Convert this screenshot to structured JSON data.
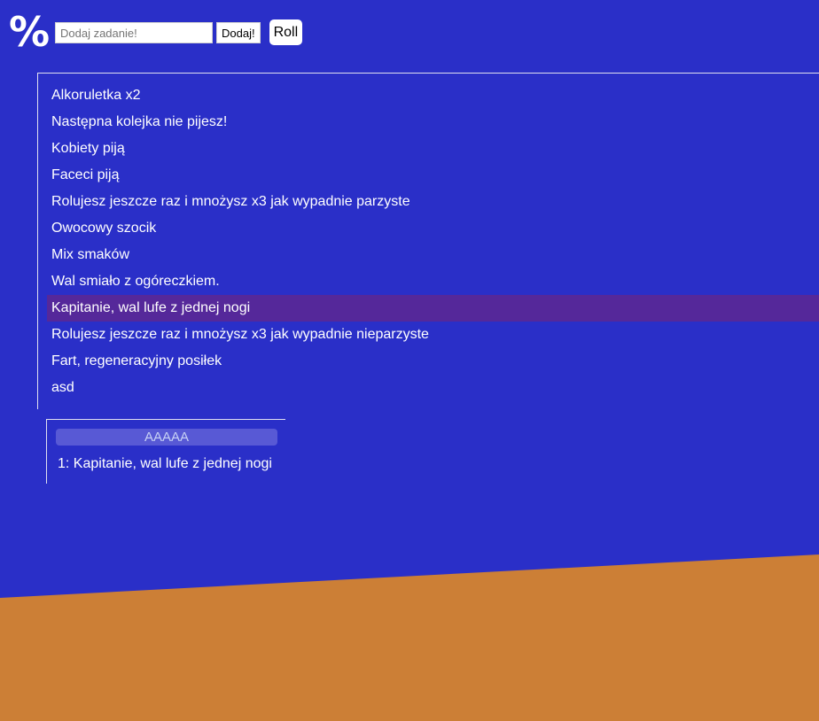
{
  "header": {
    "logo_text": "%",
    "task_input": {
      "placeholder": "Dodaj zadanie!",
      "value": ""
    },
    "add_label": "Dodaj!",
    "roll_label": "Roll"
  },
  "tasks": [
    {
      "label": "Alkoruletka x2"
    },
    {
      "label": "Następna kolejka nie pijesz!"
    },
    {
      "label": "Kobiety piją"
    },
    {
      "label": "Faceci piją"
    },
    {
      "label": "Rolujesz jeszcze raz i mnożysz x3 jak wypadnie parzyste"
    },
    {
      "label": "Owocowy szocik"
    },
    {
      "label": "Mix smaków"
    },
    {
      "label": "Wal smiało z ogóreczkiem."
    },
    {
      "label": "Kapitanie, wal lufe z jednej nogi"
    },
    {
      "label": "Rolujesz jeszcze raz i mnożysz x3 jak wypadnie nieparzyste"
    },
    {
      "label": "Fart, regeneracyjny posiłek"
    },
    {
      "label": "asd"
    }
  ],
  "selected_task_index": 8,
  "results": {
    "header": "AAAAA",
    "lines": [
      "1: Kapitanie, wal lufe z jednej nogi"
    ]
  },
  "colors": {
    "background": "#2a2fc8",
    "accent_shape": "#cc7f36",
    "highlight": "#55289a"
  }
}
